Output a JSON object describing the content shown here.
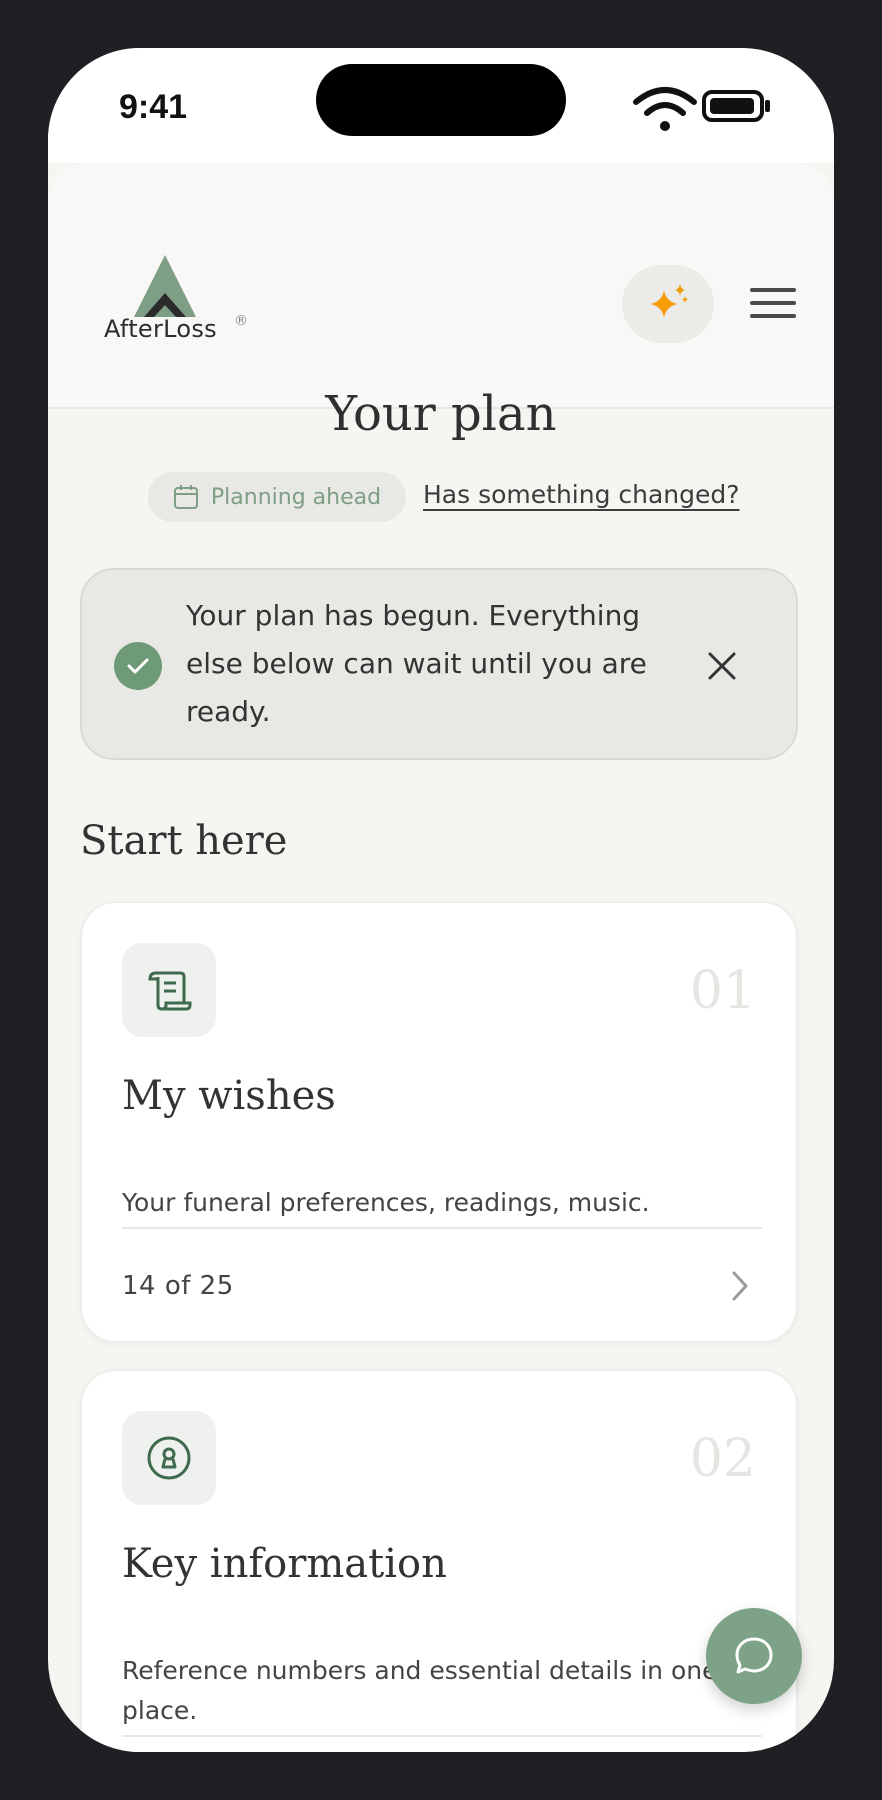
{
  "status_bar": {
    "time": "9:41"
  },
  "header": {
    "brand": "AfterLoss",
    "registered_mark": "®",
    "ai_icon": "sparkle-icon",
    "menu_icon": "hamburger-icon",
    "accent_color": "#f59e0b"
  },
  "page": {
    "title": "Your plan",
    "stage_chip": {
      "icon": "calendar-icon",
      "label": "Planning ahead"
    },
    "change_link": "Has something changed?"
  },
  "notice": {
    "icon": "check-circle-icon",
    "text": "Your plan has begun. Everything else below can wait until you are ready.",
    "close_icon": "close-icon"
  },
  "section": {
    "heading": "Start here"
  },
  "cards": [
    {
      "icon": "scroll-icon",
      "number": "01",
      "title": "My wishes",
      "description": "Your funeral preferences, readings, music.",
      "progress": "14 of 25"
    },
    {
      "icon": "keyhole-icon",
      "number": "02",
      "title": "Key information",
      "description": "Reference numbers and essential details in one place."
    }
  ],
  "chat": {
    "icon": "chat-bubble-icon"
  },
  "colors": {
    "brand_green": "#6e9a78",
    "background": "#f5f5f2",
    "notice_bg": "#e8e9e4"
  }
}
